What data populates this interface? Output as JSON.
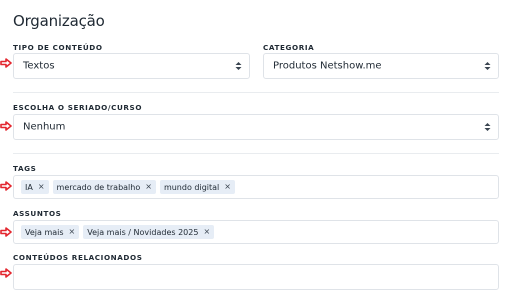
{
  "page": {
    "title": "Organização"
  },
  "content_type": {
    "label": "TIPO DE CONTEÚDO",
    "value": "Textos"
  },
  "category": {
    "label": "CATEGORIA",
    "value": "Produtos Netshow.me"
  },
  "series": {
    "label": "ESCOLHA O SERIADO/CURSO",
    "value": "Nenhum"
  },
  "tags": {
    "label": "TAGS",
    "items": [
      "IA",
      "mercado de trabalho",
      "mundo digital"
    ]
  },
  "subjects": {
    "label": "ASSUNTOS",
    "items": [
      "Veja mais",
      "Veja mais / Novidades 2025"
    ]
  },
  "related": {
    "label": "CONTEÚDOS RELACIONADOS"
  },
  "remove_icon": "×",
  "colors": {
    "pointer_arrow": "#e3262e",
    "tag_bg": "#e6edf6",
    "border": "#dfe3e8"
  }
}
